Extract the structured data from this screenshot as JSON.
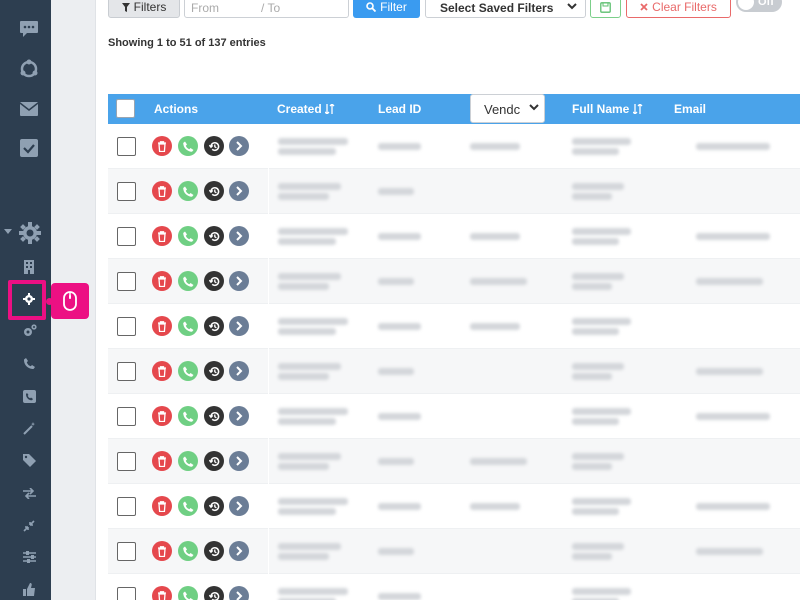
{
  "toolbar": {
    "filters_label": "Filters",
    "date_from_placeholder": "From",
    "date_sep": "/",
    "date_to_placeholder": "To",
    "filter_button_label": "Filter",
    "saved_filters_label": "Select Saved Filters",
    "clear_filters_label": "Clear Filters",
    "toggle_label": "Off"
  },
  "summary": {
    "prefix": "Showing ",
    "from": "1",
    "to_word": " to ",
    "to": "51",
    "of_word": " of ",
    "total": "137",
    "suffix": " entries"
  },
  "table": {
    "columns": {
      "actions": "Actions",
      "created": "Created",
      "lead_id": "Lead ID",
      "vendor": "Vendc",
      "full_name": "Full Name",
      "email": "Email"
    },
    "row_count": 11
  },
  "sidebar": {
    "icons": [
      "chat-icon",
      "share-icon",
      "mail-icon",
      "inbox-icon",
      "gear-large-icon",
      "building-icon",
      "gear-icon",
      "gears-icon",
      "phone-icon",
      "phone-square-icon",
      "magic-wand-icon",
      "tag-icon",
      "exchange-icon",
      "compress-icon",
      "sliders-icon",
      "thumbs-up-icon"
    ]
  },
  "colors": {
    "sidebar": "#2d3e50",
    "header": "#4aa3ea",
    "highlight": "#ec1083",
    "delete": "#e5484d",
    "call": "#6fcf83",
    "history": "#333333",
    "go": "#6b7d96"
  }
}
